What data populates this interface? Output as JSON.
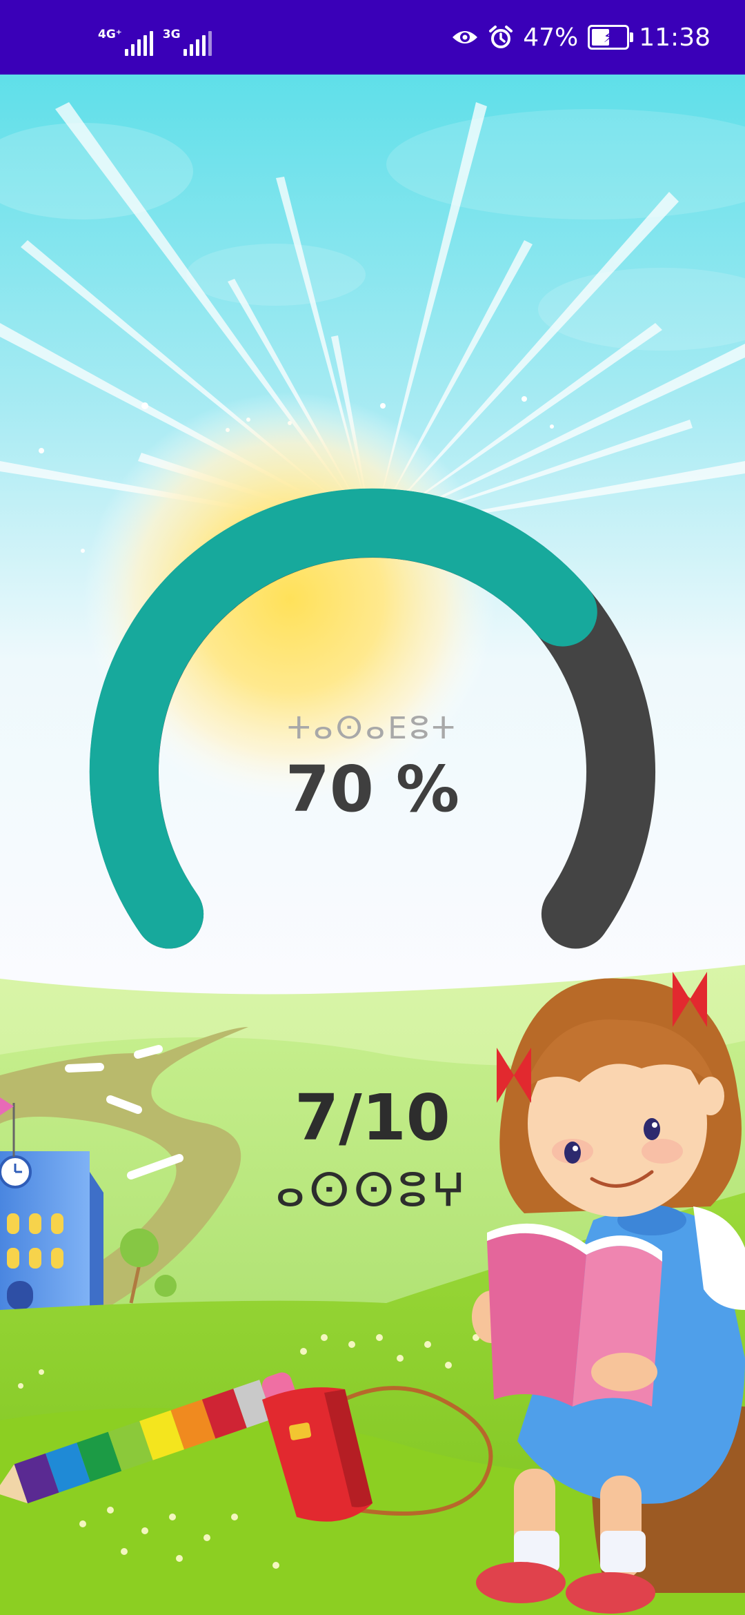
{
  "status_bar": {
    "network_1": "4G⁺",
    "network_2": "3G",
    "battery_percent": "47%",
    "time": "11:38",
    "icons": [
      "eye-icon",
      "alarm-icon",
      "battery-charging-icon",
      "signal-icon"
    ],
    "background_color": "#3a00b8"
  },
  "gauge": {
    "label": "ⵜⴰⵙⴰⴹⵓⵜ",
    "value_text": "70 %",
    "progress": 0.7,
    "progress_color": "#17a99c",
    "track_color": "#444444"
  },
  "score": {
    "value_text": "7/10",
    "label": "ⴰⵙⵙⵓⵖ"
  },
  "scene_objects": [
    "sky",
    "sun",
    "hills",
    "road",
    "school-building",
    "pencil",
    "handbag",
    "girl-reading-book"
  ]
}
